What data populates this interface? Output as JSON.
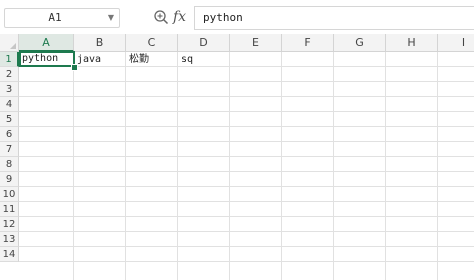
{
  "formula_bar": {
    "name_box": "A1",
    "formula": "python"
  },
  "icons": {
    "zoom": "zoom-icon",
    "fx": "fx",
    "dropdown": "chevron-down-icon"
  },
  "columns": [
    "A",
    "B",
    "C",
    "D",
    "E",
    "F",
    "G",
    "H",
    "I"
  ],
  "rows": [
    "1",
    "2",
    "3",
    "4",
    "5",
    "6",
    "7",
    "8",
    "9",
    "10",
    "11",
    "12",
    "13",
    "14"
  ],
  "cells": {
    "A1": "python",
    "B1": "java",
    "C1": "松勤",
    "D1": "sq"
  },
  "selection": {
    "column": "A",
    "row": "1"
  },
  "colors": {
    "accent": "#1e7a4f"
  }
}
